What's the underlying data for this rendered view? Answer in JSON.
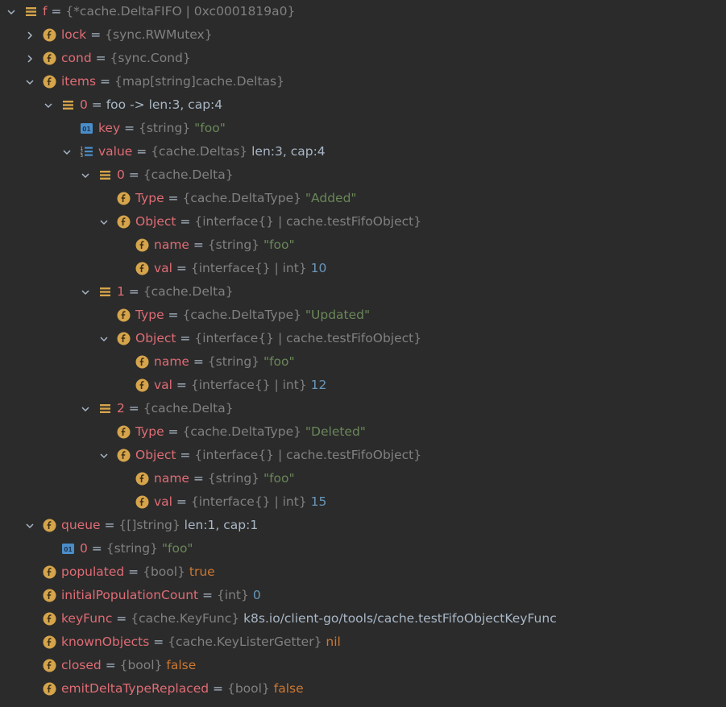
{
  "colors": {
    "background": "#2b2b2b",
    "name": "#e06c75",
    "type": "#808080",
    "string_value": "#6a8759",
    "number_value": "#6897bb",
    "keyword_value": "#cc7832",
    "plain_value": "#a9b7c6",
    "field_icon": "#d5a44b",
    "object_icon": "#d5a44b",
    "primitive_icon": "#4a8ec9"
  },
  "rows": [
    {
      "depth": 0,
      "chevron": "expanded",
      "icon": "object-icon",
      "name": "f",
      "type": "{*cache.DeltaFIFO | 0xc0001819a0}",
      "value": "",
      "value_kind": "plain"
    },
    {
      "depth": 1,
      "chevron": "collapsed",
      "icon": "field-icon",
      "name": "lock",
      "type": "{sync.RWMutex}",
      "value": "",
      "value_kind": "plain"
    },
    {
      "depth": 1,
      "chevron": "collapsed",
      "icon": "field-icon",
      "name": "cond",
      "type": "{sync.Cond}",
      "value": "",
      "value_kind": "plain"
    },
    {
      "depth": 1,
      "chevron": "expanded",
      "icon": "field-icon",
      "name": "items",
      "type": "{map[string]cache.Deltas}",
      "value": "",
      "value_kind": "plain"
    },
    {
      "depth": 2,
      "chevron": "expanded",
      "icon": "object-icon",
      "name": "0",
      "type": "",
      "value": "foo -> len:3, cap:4",
      "value_kind": "plain"
    },
    {
      "depth": 3,
      "chevron": "none",
      "icon": "primitive-icon",
      "name": "key",
      "type": "{string}",
      "value": "\"foo\"",
      "value_kind": "string"
    },
    {
      "depth": 3,
      "chevron": "expanded",
      "icon": "array-icon",
      "name": "value",
      "type": "{cache.Deltas}",
      "value": "len:3, cap:4",
      "value_kind": "plain"
    },
    {
      "depth": 4,
      "chevron": "expanded",
      "icon": "object-icon",
      "name": "0",
      "type": "{cache.Delta}",
      "value": "",
      "value_kind": "plain"
    },
    {
      "depth": 5,
      "chevron": "none",
      "icon": "field-icon",
      "name": "Type",
      "type": "{cache.DeltaType}",
      "value": "\"Added\"",
      "value_kind": "string"
    },
    {
      "depth": 5,
      "chevron": "expanded",
      "icon": "field-icon",
      "name": "Object",
      "type": "{interface{} | cache.testFifoObject}",
      "value": "",
      "value_kind": "plain"
    },
    {
      "depth": 6,
      "chevron": "none",
      "icon": "field-icon",
      "name": "name",
      "type": "{string}",
      "value": "\"foo\"",
      "value_kind": "string"
    },
    {
      "depth": 6,
      "chevron": "none",
      "icon": "field-icon",
      "name": "val",
      "type": "{interface{} | int}",
      "value": "10",
      "value_kind": "number"
    },
    {
      "depth": 4,
      "chevron": "expanded",
      "icon": "object-icon",
      "name": "1",
      "type": "{cache.Delta}",
      "value": "",
      "value_kind": "plain"
    },
    {
      "depth": 5,
      "chevron": "none",
      "icon": "field-icon",
      "name": "Type",
      "type": "{cache.DeltaType}",
      "value": "\"Updated\"",
      "value_kind": "string"
    },
    {
      "depth": 5,
      "chevron": "expanded",
      "icon": "field-icon",
      "name": "Object",
      "type": "{interface{} | cache.testFifoObject}",
      "value": "",
      "value_kind": "plain"
    },
    {
      "depth": 6,
      "chevron": "none",
      "icon": "field-icon",
      "name": "name",
      "type": "{string}",
      "value": "\"foo\"",
      "value_kind": "string"
    },
    {
      "depth": 6,
      "chevron": "none",
      "icon": "field-icon",
      "name": "val",
      "type": "{interface{} | int}",
      "value": "12",
      "value_kind": "number"
    },
    {
      "depth": 4,
      "chevron": "expanded",
      "icon": "object-icon",
      "name": "2",
      "type": "{cache.Delta}",
      "value": "",
      "value_kind": "plain"
    },
    {
      "depth": 5,
      "chevron": "none",
      "icon": "field-icon",
      "name": "Type",
      "type": "{cache.DeltaType}",
      "value": "\"Deleted\"",
      "value_kind": "string"
    },
    {
      "depth": 5,
      "chevron": "expanded",
      "icon": "field-icon",
      "name": "Object",
      "type": "{interface{} | cache.testFifoObject}",
      "value": "",
      "value_kind": "plain"
    },
    {
      "depth": 6,
      "chevron": "none",
      "icon": "field-icon",
      "name": "name",
      "type": "{string}",
      "value": "\"foo\"",
      "value_kind": "string"
    },
    {
      "depth": 6,
      "chevron": "none",
      "icon": "field-icon",
      "name": "val",
      "type": "{interface{} | int}",
      "value": "15",
      "value_kind": "number"
    },
    {
      "depth": 1,
      "chevron": "expanded",
      "icon": "field-icon",
      "name": "queue",
      "type": "{[]string}",
      "value": "len:1, cap:1",
      "value_kind": "plain"
    },
    {
      "depth": 2,
      "chevron": "none",
      "icon": "primitive-icon",
      "name": "0",
      "type": "{string}",
      "value": "\"foo\"",
      "value_kind": "string"
    },
    {
      "depth": 1,
      "chevron": "none",
      "icon": "field-icon",
      "name": "populated",
      "type": "{bool}",
      "value": "true",
      "value_kind": "keyword"
    },
    {
      "depth": 1,
      "chevron": "none",
      "icon": "field-icon",
      "name": "initialPopulationCount",
      "type": "{int}",
      "value": "0",
      "value_kind": "number"
    },
    {
      "depth": 1,
      "chevron": "none",
      "icon": "field-icon",
      "name": "keyFunc",
      "type": "{cache.KeyFunc}",
      "value": "k8s.io/client-go/tools/cache.testFifoObjectKeyFunc",
      "value_kind": "plain"
    },
    {
      "depth": 1,
      "chevron": "none",
      "icon": "field-icon",
      "name": "knownObjects",
      "type": "{cache.KeyListerGetter}",
      "value": "nil",
      "value_kind": "keyword"
    },
    {
      "depth": 1,
      "chevron": "none",
      "icon": "field-icon",
      "name": "closed",
      "type": "{bool}",
      "value": "false",
      "value_kind": "keyword"
    },
    {
      "depth": 1,
      "chevron": "none",
      "icon": "field-icon",
      "name": "emitDeltaTypeReplaced",
      "type": "{bool}",
      "value": "false",
      "value_kind": "keyword"
    }
  ]
}
